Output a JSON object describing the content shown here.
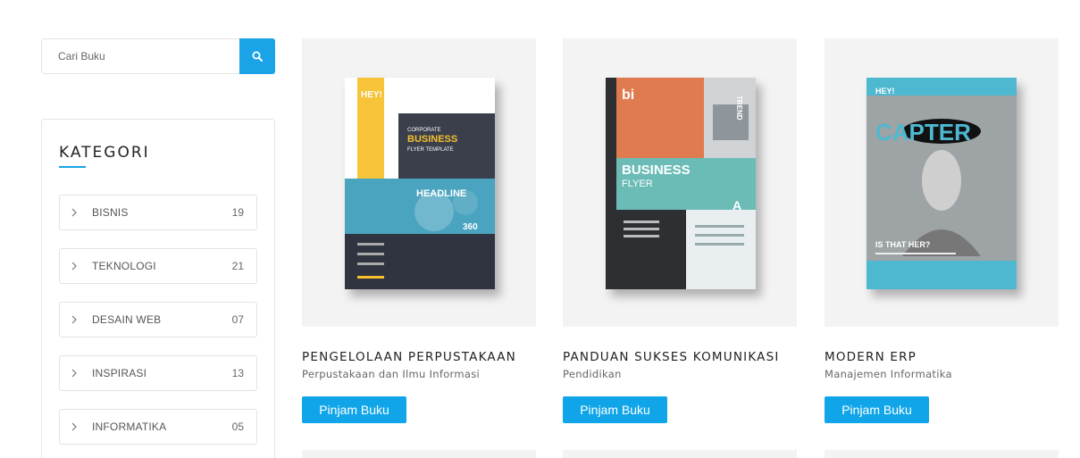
{
  "search": {
    "placeholder": "Cari Buku",
    "icon": "search-icon"
  },
  "sidebar": {
    "title": "KATEGORI",
    "accent": "#1aa3e6",
    "items": [
      {
        "label": "BISNIS",
        "count": "19"
      },
      {
        "label": "TEKNOLOGI",
        "count": "21"
      },
      {
        "label": "DESAIN WEB",
        "count": "07"
      },
      {
        "label": "INSPIRASI",
        "count": "13"
      },
      {
        "label": "INFORMATIKA",
        "count": "05"
      }
    ]
  },
  "books": [
    {
      "title": "PENGELOLAAN PERPUSTAKAAN",
      "category": "Perpustakaan dan Ilmu Informasi",
      "button": "Pinjam Buku",
      "cover": {
        "hey": "HEY!",
        "line1": "CORPORATE",
        "line2": "BUSINESS",
        "line3": "FLYER TEMPLATE",
        "headline": "HEADLINE",
        "number": "360"
      }
    },
    {
      "title": "PANDUAN SUKSES KOMUNIKASI",
      "category": "Pendidikan",
      "button": "Pinjam Buku",
      "cover": {
        "bi": "bi",
        "trend": "TREND",
        "line1": "BUSINESS",
        "line2": "FLYER",
        "letter": "A"
      }
    },
    {
      "title": "MODERN ERP",
      "category": "Manajemen Informatika",
      "button": "Pinjam Buku",
      "cover": {
        "hey": "HEY!",
        "word": "CAPTER",
        "tagline": "IS THAT HER?"
      }
    }
  ],
  "colors": {
    "button": "#0fa5e8",
    "card_bg": "#f3f3f3"
  }
}
